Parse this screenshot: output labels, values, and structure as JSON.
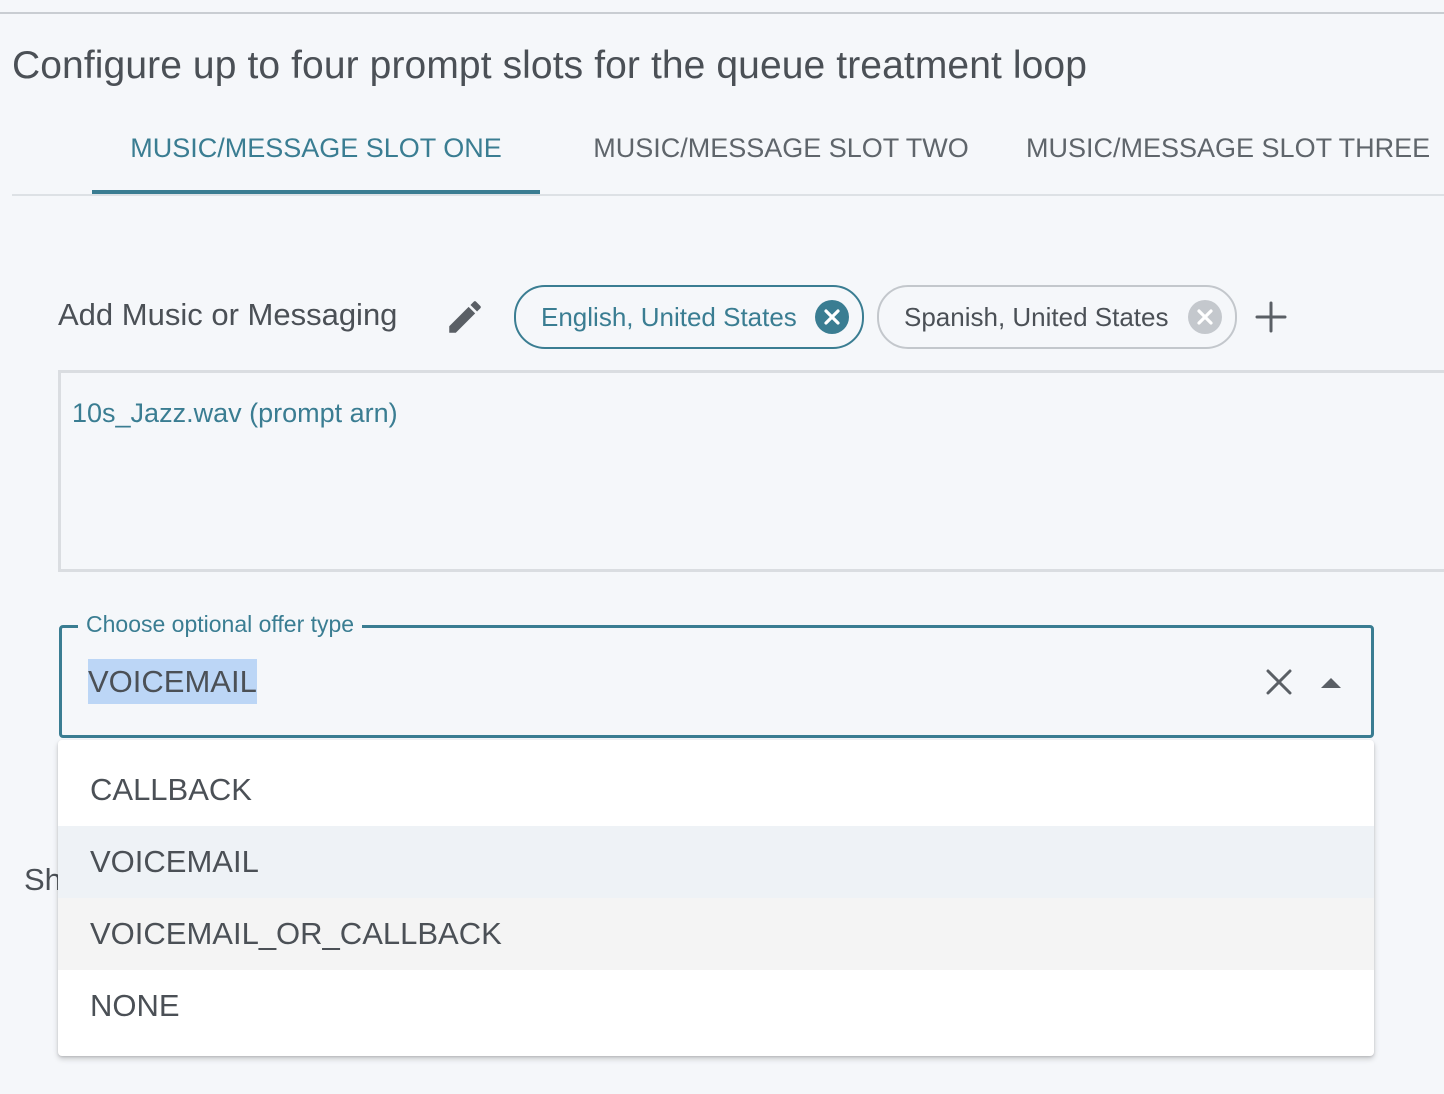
{
  "page_title": "Configure up to four prompt slots for the queue treatment loop",
  "tabs": [
    {
      "label": "MUSIC/MESSAGE SLOT ONE",
      "active": true
    },
    {
      "label": "MUSIC/MESSAGE SLOT TWO",
      "active": false
    },
    {
      "label": "MUSIC/MESSAGE SLOT THREE",
      "active": false
    }
  ],
  "music_row": {
    "label": "Add Music or Messaging",
    "edit_icon": "pencil-icon",
    "add_icon": "plus-icon",
    "languages": [
      {
        "label": "English, United States",
        "selected": true
      },
      {
        "label": "Spanish, United States",
        "selected": false
      }
    ]
  },
  "prompt": {
    "text": "10s_Jazz.wav (prompt arn)"
  },
  "offer_select": {
    "label": "Choose optional offer type",
    "value": "VOICEMAIL",
    "clear_icon": "close-icon",
    "toggle_icon": "caret-up-icon",
    "options": [
      "CALLBACK",
      "VOICEMAIL",
      "VOICEMAIL_OR_CALLBACK",
      "NONE"
    ],
    "selected_option": "VOICEMAIL",
    "hovered_option": "VOICEMAIL_OR_CALLBACK"
  },
  "obscured_label_fragment": "Sh",
  "colors": {
    "accent": "#3a7d92",
    "text": "#4b5056",
    "background": "#f5f7fa",
    "selection_highlight": "#bcd6f6"
  }
}
